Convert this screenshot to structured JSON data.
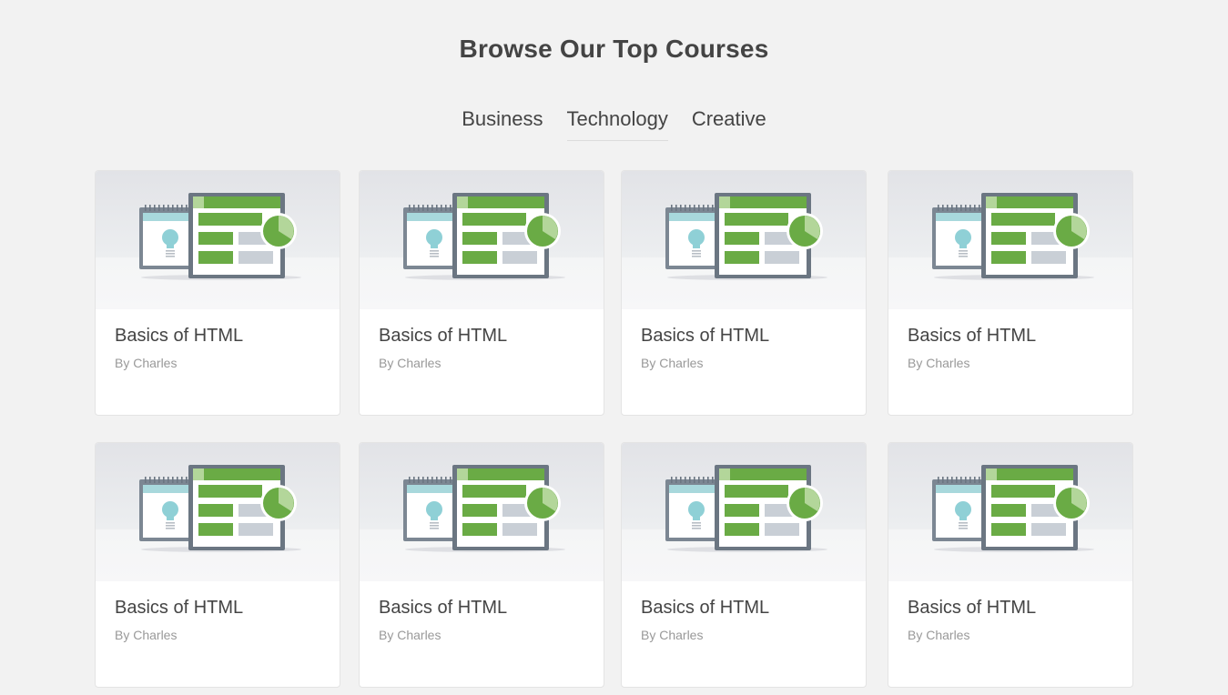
{
  "header": {
    "title": "Browse Our Top Courses"
  },
  "tabs": [
    {
      "label": "Business",
      "active": false
    },
    {
      "label": "Technology",
      "active": true
    },
    {
      "label": "Creative",
      "active": false
    }
  ],
  "courses": [
    {
      "title": "Basics of HTML",
      "author": "By Charles",
      "thumbnail_icon": "spreadsheet-calendar-illustration"
    },
    {
      "title": "Basics of HTML",
      "author": "By Charles",
      "thumbnail_icon": "spreadsheet-calendar-illustration"
    },
    {
      "title": "Basics of HTML",
      "author": "By Charles",
      "thumbnail_icon": "spreadsheet-calendar-illustration"
    },
    {
      "title": "Basics of HTML",
      "author": "By Charles",
      "thumbnail_icon": "spreadsheet-calendar-illustration"
    },
    {
      "title": "Basics of HTML",
      "author": "By Charles",
      "thumbnail_icon": "spreadsheet-calendar-illustration"
    },
    {
      "title": "Basics of HTML",
      "author": "By Charles",
      "thumbnail_icon": "spreadsheet-calendar-illustration"
    },
    {
      "title": "Basics of HTML",
      "author": "By Charles",
      "thumbnail_icon": "spreadsheet-calendar-illustration"
    },
    {
      "title": "Basics of HTML",
      "author": "By Charles",
      "thumbnail_icon": "spreadsheet-calendar-illustration"
    }
  ],
  "colors": {
    "background": "#f2f2f2",
    "accent_green": "#6aab45",
    "light_green": "#b3d69a",
    "frame_gray": "#6b7682",
    "calendar_teal": "#a8d8dc",
    "bulb_teal": "#8fd0d6"
  }
}
